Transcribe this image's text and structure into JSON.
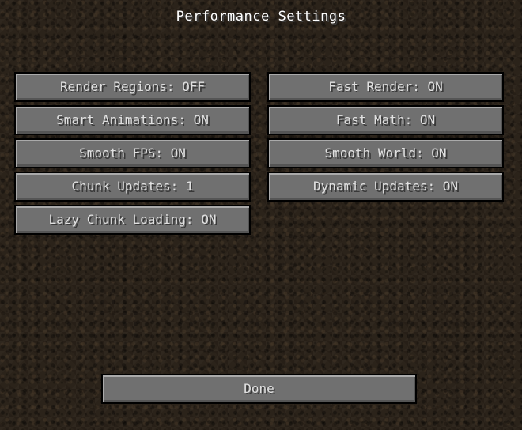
{
  "screen": {
    "title": "Performance Settings"
  },
  "options": {
    "left": [
      {
        "label": "Render Regions: OFF"
      },
      {
        "label": "Smart Animations: ON"
      },
      {
        "label": "Smooth FPS: ON"
      },
      {
        "label": "Chunk Updates: 1"
      },
      {
        "label": "Lazy Chunk Loading: ON"
      }
    ],
    "right": [
      {
        "label": "Fast Render: ON"
      },
      {
        "label": "Fast Math: ON"
      },
      {
        "label": "Smooth World: ON"
      },
      {
        "label": "Dynamic Updates: ON"
      }
    ]
  },
  "footer": {
    "done_label": "Done"
  },
  "colors": {
    "background": "#2b231a",
    "button_face": "#707070",
    "button_text": "#e0e0e0",
    "title_text": "#ffffff"
  }
}
